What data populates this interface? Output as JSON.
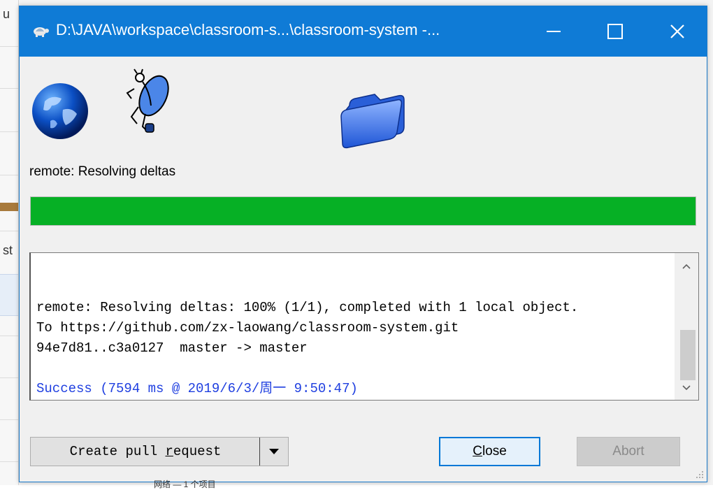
{
  "window": {
    "title": "D:\\JAVA\\workspace\\classroom-s...\\classroom-system -...",
    "title_icon": "tortoise-icon",
    "controls": [
      "minimize",
      "maximize",
      "close"
    ],
    "accent_color": "#0f7bd6"
  },
  "animation": {
    "icons": [
      "globe-icon",
      "running-turtle-icon",
      "folder-icon"
    ]
  },
  "status": {
    "label": "remote: Resolving deltas",
    "progress_fraction": 1.0,
    "progress_color": "#06b025"
  },
  "log": {
    "lines": [
      "remote: Resolving deltas: 100% (1/1), completed with 1 local object.",
      "To https://github.com/zx-laowang/classroom-system.git",
      "94e7d81..c3a0127  master -> master",
      ""
    ],
    "success_line": "Success (7594 ms @ 2019/6/3/周一 9:50:47)",
    "success_color": "#1f3fe0"
  },
  "buttons": {
    "create_pr_prefix": "Create pull ",
    "create_pr_accel": "r",
    "create_pr_suffix": "equest",
    "close_accel": "C",
    "close_rest": "lose",
    "abort": "Abort"
  },
  "background": {
    "side_texts": [
      "u",
      "st"
    ],
    "bottom_text": "网络 — 1 个项目"
  }
}
